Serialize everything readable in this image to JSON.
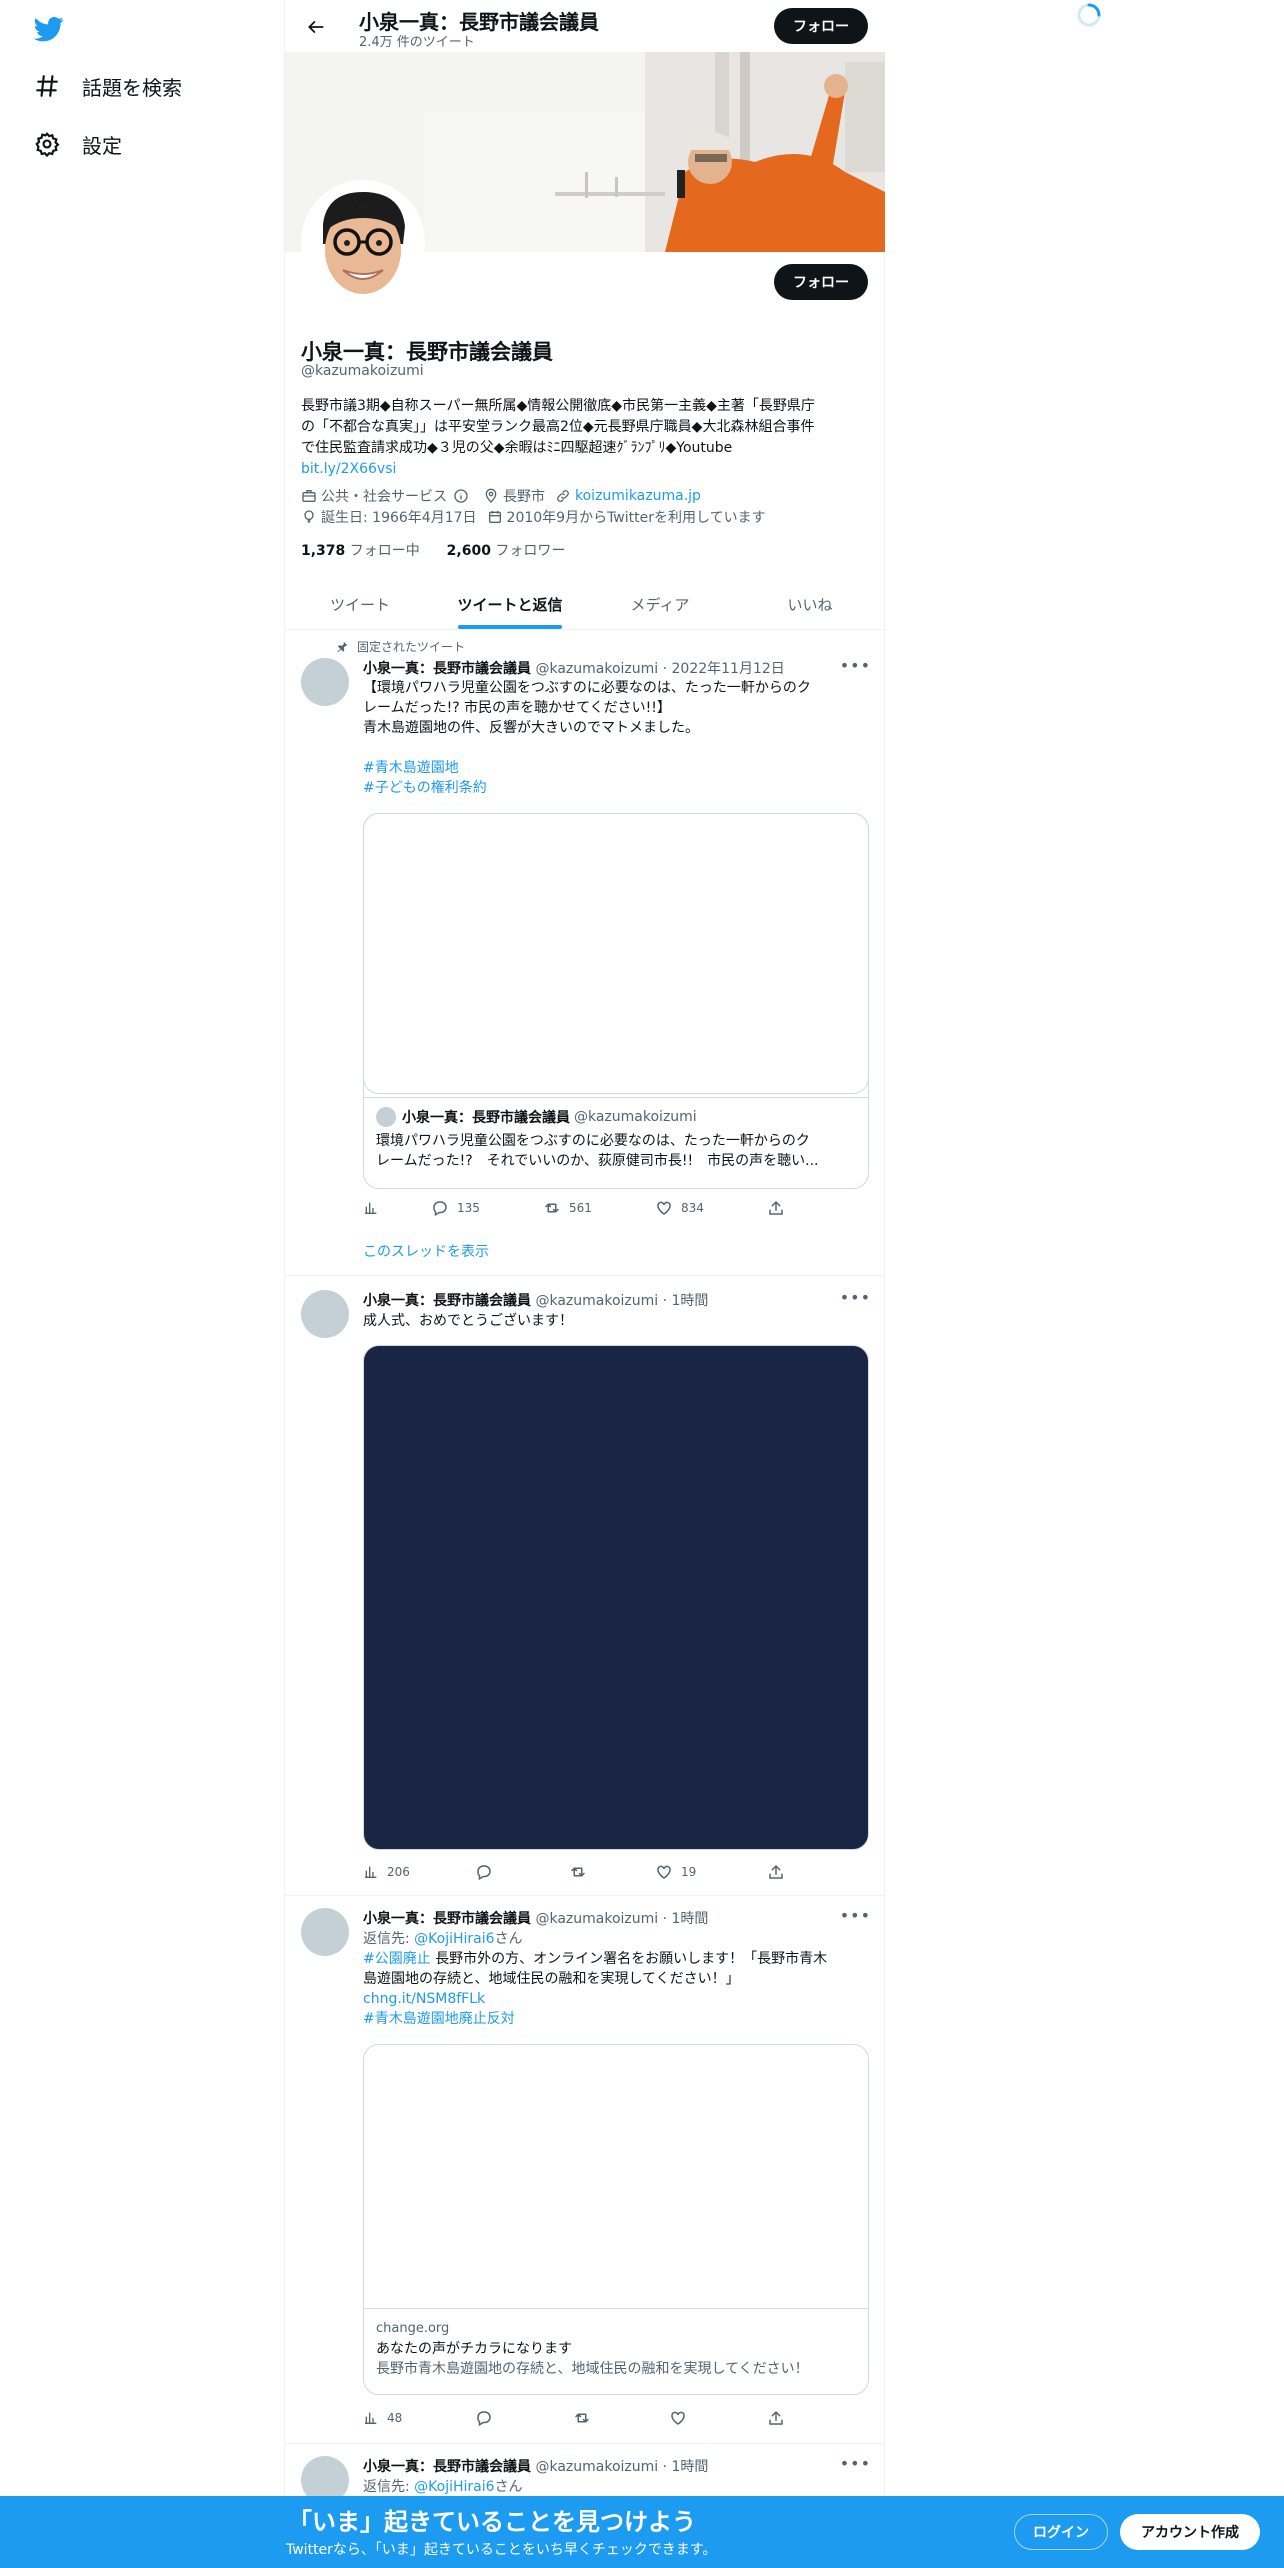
{
  "nav": {
    "logo": "twitter-bird-icon",
    "items": [
      {
        "icon": "hashtag-icon",
        "label": "話題を検索"
      },
      {
        "icon": "gear-icon",
        "label": "設定"
      }
    ]
  },
  "header": {
    "name": "小泉一真：長野市議会議員",
    "tweet_count": "2.4万 件のツイート",
    "follow_label": "フォロー"
  },
  "profile": {
    "name": "小泉一真：長野市議会議員",
    "handle": "@kazumakoizumi",
    "bio_lines": [
      "長野市議3期◆自称スーパー無所属◆情報公開徹底◆市民第一主義◆主著「長野県庁",
      "の「不都合な真実」」は平安堂ランク最高2位◆元長野県庁職員◆大北森林組合事件",
      "で住民監査請求成功◆３児の父◆余暇はﾐﾆ四駆超速ｸﾞﾗﾝﾌﾟﾘ◆Youtube"
    ],
    "bio_link": "bit.ly/2X66vsi",
    "category": "公共・社会サービス",
    "location": "長野市",
    "website": "koizumikazuma.jp",
    "birthday": "誕生日: 1966年4月17日",
    "joined": "2010年9月からTwitterを利用しています",
    "following_count": "1,378",
    "following_label": "フォロー中",
    "followers_count": "2,600",
    "followers_label": "フォロワー",
    "follow_label": "フォロー"
  },
  "tabs": [
    {
      "label": "ツイート",
      "active": false
    },
    {
      "label": "ツイートと返信",
      "active": true
    },
    {
      "label": "メディア",
      "active": false
    },
    {
      "label": "いいね",
      "active": false
    }
  ],
  "tweets": [
    {
      "pinned_label": "固定されたツイート",
      "name": "小泉一真：長野市議会議員",
      "handle": "@kazumakoizumi",
      "time": "2022年11月12日",
      "lines": [
        "【環境パワハラ児童公園をつぶすのに必要なのは、たった一軒からのク",
        "レームだった!? 市民の声を聴かせてください!!】",
        "青木島遊園地の件、反響が大きいのでマトメました。"
      ],
      "hashtags": [
        "#青木島遊園地",
        "#子どもの権利条約"
      ],
      "quote": {
        "name": "小泉一真：長野市議会議員",
        "handle": "@kazumakoizumi",
        "text1": "環境パワハラ児童公園をつぶすのに必要なのは、たった一軒からのク",
        "text2": "レームだった!?　それでいいのか、荻原健司市長!!　市民の声を聴い..."
      },
      "replies": "135",
      "retweets": "561",
      "likes": "834",
      "thread_link": "このスレッドを表示"
    },
    {
      "name": "小泉一真：長野市議会議員",
      "handle": "@kazumakoizumi",
      "time": "1時間",
      "text": "成人式、おめでとうございます！",
      "views": "206",
      "likes": "19"
    },
    {
      "name": "小泉一真：長野市議会議員",
      "handle": "@kazumakoizumi",
      "time": "1時間",
      "reply_prefix": "返信先: ",
      "reply_to": "@KojiHirai6",
      "reply_suffix": "さん",
      "hashtag1": "#公園廃止",
      "text1": " 長野市外の方、オンライン署名をお願いします！「長野市青木",
      "text2": "島遊園地の存続と、地域住民の融和を実現してください！」",
      "link": "chng.it/NSM8fFLk",
      "hashtag2": "#青木島遊園地廃止反対",
      "card": {
        "domain": "change.org",
        "title": "あなたの声がチカラになります",
        "desc": "長野市青木島遊園地の存続と、地域住民の融和を実現してください！"
      },
      "views": "48"
    },
    {
      "name": "小泉一真：長野市議会議員",
      "handle": "@kazumakoizumi",
      "time": "1時間",
      "reply_prefix": "返信先: ",
      "reply_to": "@KojiHirai6",
      "reply_suffix": "さん"
    }
  ],
  "bottom_bar": {
    "title": "「いま」起きていることを見つけよう",
    "subtitle": "Twitterなら、「いま」起きていることをいち早くチェックできます。",
    "login": "ログイン",
    "signup": "アカウント作成"
  },
  "colors": {
    "accent": "#1d9bf0",
    "text": "#0f1419",
    "muted": "#536471",
    "media_dark": "#1a2445"
  }
}
